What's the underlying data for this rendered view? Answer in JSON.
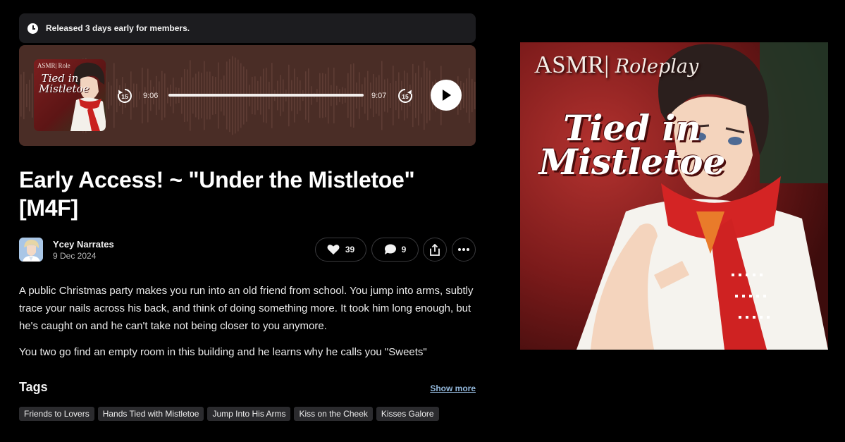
{
  "notice": {
    "text": "Released 3 days early for members."
  },
  "player": {
    "cover": {
      "line1": "ASMR| Role",
      "line2": "Tied in Mistletoe"
    },
    "current_time": "9:06",
    "end_time": "9:07",
    "progress_fraction": 0.99,
    "skip_back_seconds": "15",
    "skip_forward_seconds": "15",
    "background_color": "#4a2d26"
  },
  "post": {
    "title": "Early Access! ~ \"Under the Mistletoe\" [M4F]",
    "author": "Ycey Narrates",
    "date": "9 Dec 2024",
    "likes": "39",
    "comments": "9",
    "description": [
      "A public Christmas party makes you run into an old friend from school. You jump into arms, subtly trace your nails across his back, and think of doing something more. It took him long enough, but he's caught on and he can't take not being closer to you anymore.",
      "You two go find an empty room in this building and he learns why he calls you \"Sweets\""
    ]
  },
  "tags": {
    "heading": "Tags",
    "show_more": "Show more",
    "items": [
      "Friends to Lovers",
      "Hands Tied with Mistletoe",
      "Jump Into His Arms",
      "Kiss on the Cheek",
      "Kisses Galore"
    ]
  },
  "artwork": {
    "line1": "ASMR|",
    "line1_italic": " Roleplay",
    "title": "Tied in Mistletoe"
  },
  "icons": {
    "notice": "clock-icon",
    "rewind": "rewind-15-icon",
    "forward": "forward-15-icon",
    "play": "play-icon",
    "like": "heart-icon",
    "comment": "comment-icon",
    "share": "share-icon",
    "more": "more-dots-icon"
  }
}
